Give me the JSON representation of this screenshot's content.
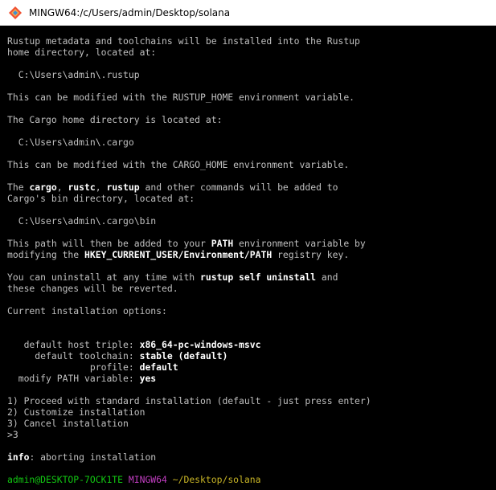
{
  "window": {
    "title": "MINGW64:/c/Users/admin/Desktop/solana",
    "icon": "git-bash-diamond-icon"
  },
  "terminal": {
    "lines": [
      [
        {
          "t": "Rustup metadata and toolchains will be installed into the Rustup"
        }
      ],
      [
        {
          "t": "home directory, located at:"
        }
      ],
      [],
      [
        {
          "t": "  C:\\Users\\admin\\.rustup"
        }
      ],
      [],
      [
        {
          "t": "This can be modified with the RUSTUP_HOME environment variable."
        }
      ],
      [],
      [
        {
          "t": "The Cargo home directory is located at:"
        }
      ],
      [],
      [
        {
          "t": "  C:\\Users\\admin\\.cargo"
        }
      ],
      [],
      [
        {
          "t": "This can be modified with the CARGO_HOME environment variable."
        }
      ],
      [],
      [
        {
          "t": "The "
        },
        {
          "t": "cargo",
          "s": "b"
        },
        {
          "t": ", "
        },
        {
          "t": "rustc",
          "s": "b"
        },
        {
          "t": ", "
        },
        {
          "t": "rustup",
          "s": "b"
        },
        {
          "t": " and other commands will be added to"
        }
      ],
      [
        {
          "t": "Cargo's bin directory, located at:"
        }
      ],
      [],
      [
        {
          "t": "  C:\\Users\\admin\\.cargo\\bin"
        }
      ],
      [],
      [
        {
          "t": "This path will then be added to your "
        },
        {
          "t": "PATH",
          "s": "b"
        },
        {
          "t": " environment variable by"
        }
      ],
      [
        {
          "t": "modifying the "
        },
        {
          "t": "HKEY_CURRENT_USER/Environment/PATH",
          "s": "b"
        },
        {
          "t": " registry key."
        }
      ],
      [],
      [
        {
          "t": "You can uninstall at any time with "
        },
        {
          "t": "rustup self uninstall",
          "s": "b"
        },
        {
          "t": " and"
        }
      ],
      [
        {
          "t": "these changes will be reverted."
        }
      ],
      [],
      [
        {
          "t": "Current installation options:"
        }
      ],
      [],
      [],
      [
        {
          "t": "   default host triple: "
        },
        {
          "t": "x86_64-pc-windows-msvc",
          "s": "b"
        }
      ],
      [
        {
          "t": "     default toolchain: "
        },
        {
          "t": "stable (default)",
          "s": "b"
        }
      ],
      [
        {
          "t": "               profile: "
        },
        {
          "t": "default",
          "s": "b"
        }
      ],
      [
        {
          "t": "  modify PATH variable: "
        },
        {
          "t": "yes",
          "s": "b"
        }
      ],
      [],
      [
        {
          "t": "1) Proceed with standard installation (default - just press enter)"
        }
      ],
      [
        {
          "t": "2) Customize installation"
        }
      ],
      [
        {
          "t": "3) Cancel installation"
        }
      ],
      [
        {
          "t": ">3"
        }
      ],
      [],
      [
        {
          "t": "info",
          "s": "b"
        },
        {
          "t": ": aborting installation"
        }
      ],
      [],
      [
        {
          "t": "admin@DESKTOP-7OCK1TE",
          "s": "p-user"
        },
        {
          "t": " "
        },
        {
          "t": "MINGW64",
          "s": "p-sys"
        },
        {
          "t": " "
        },
        {
          "t": "~/Desktop/solana",
          "s": "p-path"
        }
      ]
    ]
  },
  "colors": {
    "background": "#000000",
    "text": "#c0c0c0",
    "bold_text": "#ffffff",
    "prompt_user": "#12c712",
    "prompt_system": "#c23ec2",
    "prompt_path": "#c8b526"
  }
}
